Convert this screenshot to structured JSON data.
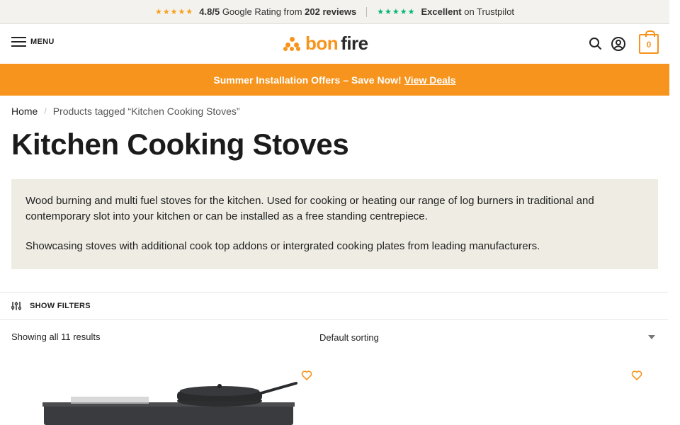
{
  "topbar": {
    "google_stars": "★★★★★",
    "google_score": "4.8/5",
    "google_text_a": "Google Rating from",
    "google_count": "202 reviews",
    "trust_stars": "★★★★★",
    "trust_excellent": "Excellent",
    "trust_text": "on Trustpilot"
  },
  "header": {
    "menu_label": "MENU",
    "logo_word1": "bon",
    "logo_word2": "fire",
    "cart_count": "0"
  },
  "promo": {
    "text": "Summer Installation Offers – Save Now!",
    "link": "View Deals"
  },
  "breadcrumb": {
    "home": "Home",
    "separator": "/",
    "current": "Products tagged “Kitchen Cooking Stoves”"
  },
  "page_title": "Kitchen Cooking Stoves",
  "description": {
    "p1": "Wood burning and multi fuel stoves for the kitchen. Used for cooking or heating our range of log burners in traditional and contemporary slot into your kitchen or can be installed as a free standing centrepiece.",
    "p2": "Showcasing stoves with additional cook top addons or intergrated cooking plates from leading manufacturers."
  },
  "filters": {
    "label": "SHOW FILTERS"
  },
  "results": {
    "count_text": "Showing all 11 results"
  },
  "sorting": {
    "selected": "Default sorting"
  },
  "colors": {
    "accent": "#f7941d",
    "trustpilot": "#00b67a",
    "desc_bg": "#eeece3"
  }
}
